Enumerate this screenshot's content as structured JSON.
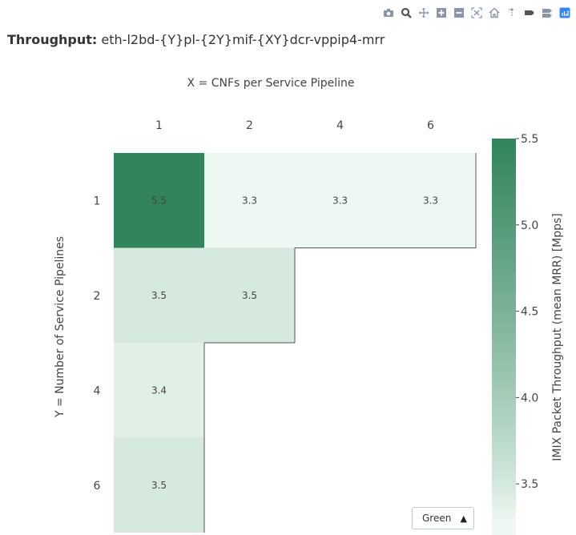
{
  "title": {
    "bold": "Throughput:",
    "text": "eth-l2bd-{Y}pl-{2Y}mif-{XY}dcr-vppip4-mrr"
  },
  "modebar": [
    "camera-icon",
    "zoom-icon",
    "pan-icon",
    "zoom-in-icon",
    "zoom-out-icon",
    "autoscale-icon",
    "reset-axes-icon",
    "spike-lines-icon",
    "hover-closest-icon",
    "hover-compare-icon",
    "plotly-logo-icon"
  ],
  "dropdown": {
    "selected": "Green",
    "arrow": "▲"
  },
  "chart_data": {
    "type": "heatmap",
    "xlabel": "X = CNFs per Service Pipeline",
    "ylabel": "Y = Number of Service Pipelines",
    "x_categories": [
      "1",
      "2",
      "4",
      "6"
    ],
    "y_categories": [
      "1",
      "2",
      "4",
      "6"
    ],
    "values": [
      [
        5.5,
        3.3,
        3.3,
        3.3
      ],
      [
        3.5,
        3.5,
        null,
        null
      ],
      [
        3.4,
        null,
        null,
        null
      ],
      [
        3.5,
        null,
        null,
        null
      ]
    ],
    "colorbar": {
      "title": "IMIX Packet Throughput (mean MRR) [Mpps]",
      "ticks": [
        "5.5",
        "5.0",
        "4.5",
        "4.0",
        "3.5"
      ],
      "tick_values": [
        5.5,
        5.0,
        4.5,
        4.0,
        3.5
      ],
      "range": [
        3.3,
        5.5
      ]
    },
    "colorscale": "Greens",
    "color_low": "#eef8f2",
    "color_high": "#31845b"
  }
}
